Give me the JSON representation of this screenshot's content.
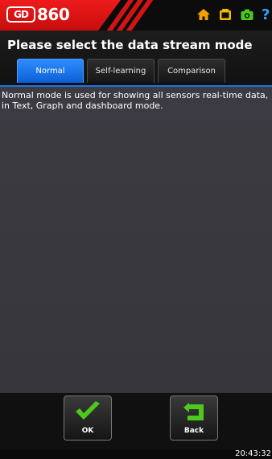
{
  "header": {
    "logo_badge": "GD",
    "logo_model": "860",
    "icons": [
      "home-icon",
      "folder-icon",
      "camera-icon",
      "help-icon"
    ]
  },
  "page": {
    "title": "Please select the data stream mode"
  },
  "tabs": [
    {
      "label": "Normal",
      "active": true
    },
    {
      "label": "Self-learning",
      "active": false
    },
    {
      "label": "Comparison",
      "active": false
    }
  ],
  "content": {
    "description": "Normal mode is used for showing all sensors real-time data, in Text, Graph and dashboard mode."
  },
  "footer": {
    "ok_label": "OK",
    "back_label": "Back"
  },
  "status": {
    "time": "20:43:32"
  },
  "colors": {
    "brand_red": "#E31B1B",
    "tab_active_blue": "#1E6FE0",
    "content_bg": "#3A393F",
    "accent_green": "#4CC81E",
    "home_orange": "#F5A000",
    "help_blue": "#2FA0FF"
  }
}
